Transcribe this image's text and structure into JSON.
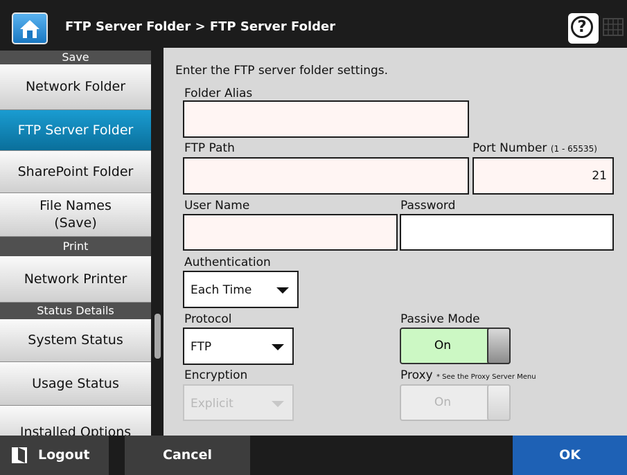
{
  "header": {
    "title": "FTP Server Folder > FTP Server Folder",
    "help_glyph": "?",
    "home_icon": "home-icon",
    "keyboard_icon": "keyboard-icon"
  },
  "sidebar": {
    "sections": [
      {
        "heading": "Save",
        "items": [
          {
            "label": "Network Folder",
            "active": false
          },
          {
            "label": "FTP Server Folder",
            "active": true
          },
          {
            "label": "SharePoint Folder",
            "active": false
          },
          {
            "label": "File Names (Save)",
            "active": false
          }
        ]
      },
      {
        "heading": "Print",
        "items": [
          {
            "label": "Network Printer",
            "active": false
          }
        ]
      },
      {
        "heading": "Status Details",
        "items": [
          {
            "label": "System Status",
            "active": false
          },
          {
            "label": "Usage Status",
            "active": false
          },
          {
            "label": "Installed Options",
            "active": false
          }
        ]
      }
    ]
  },
  "form": {
    "intro": "Enter the FTP server folder settings.",
    "folder_alias": {
      "label": "Folder Alias",
      "value": ""
    },
    "ftp_path": {
      "label": "FTP Path",
      "value": ""
    },
    "port_number": {
      "label": "Port Number",
      "range": "(1 - 65535)",
      "value": "21"
    },
    "user_name": {
      "label": "User Name",
      "value": ""
    },
    "password": {
      "label": "Password",
      "value": ""
    },
    "authentication": {
      "label": "Authentication",
      "value": "Each Time"
    },
    "protocol": {
      "label": "Protocol",
      "value": "FTP"
    },
    "encryption": {
      "label": "Encryption",
      "value": "Explicit",
      "disabled": true
    },
    "passive_mode": {
      "label": "Passive Mode",
      "value": "On",
      "color": "#ccf8c4"
    },
    "proxy": {
      "label": "Proxy",
      "note": "* See the Proxy Server Menu",
      "value": "On",
      "disabled": true
    }
  },
  "footer": {
    "logout": "Logout",
    "cancel": "Cancel",
    "ok": "OK",
    "ok_color": "#1e61b5"
  }
}
